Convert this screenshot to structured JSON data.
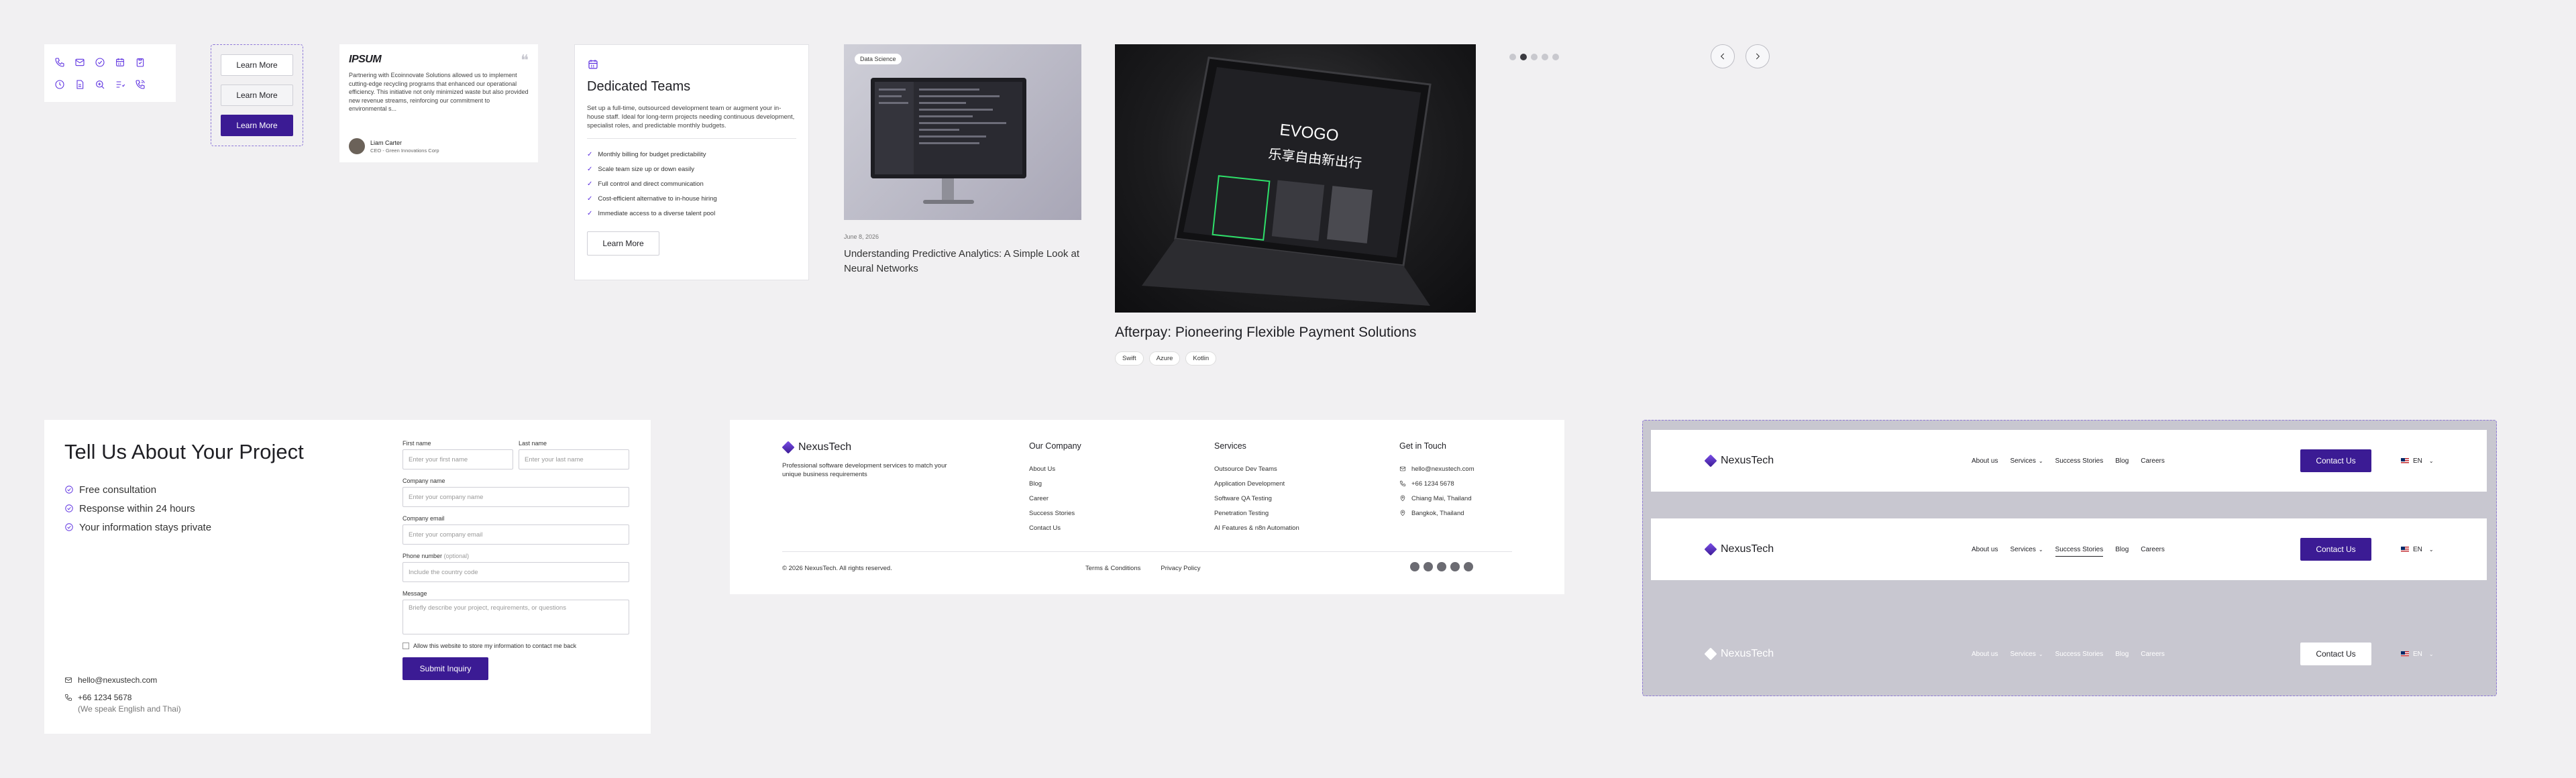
{
  "buttons": {
    "learn_more": "Learn More"
  },
  "icons": [
    "phone-icon",
    "mail-icon",
    "check-circle-icon",
    "calendar-icon",
    "clipboard-icon",
    "clock-icon",
    "document-icon",
    "search-plus-icon",
    "list-icon",
    "phone-call-icon"
  ],
  "testimonial": {
    "logo": "IPSUM",
    "quote": "Partnering with Ecoinnovate Solutions allowed us to implement cutting-edge recycling programs that enhanced our operational efficiency. This initiative not only minimized waste but also provided new revenue streams, reinforcing our commitment to environmental s...",
    "name": "Liam Carter",
    "role": "CEO - Green Innovations Corp"
  },
  "teams": {
    "title": "Dedicated Teams",
    "description": "Set up a full-time, outsourced development team or augment your in-house staff. Ideal for long-term projects needing continuous development, specialist roles, and predictable monthly budgets.",
    "features": [
      "Monthly billing for budget predictability",
      "Scale team size up or down easily",
      "Full control and direct communication",
      "Cost-efficient alternative to in-house hiring",
      "Immediate access to a diverse talent pool"
    ],
    "button": "Learn More"
  },
  "blog": {
    "badge": "Data Science",
    "date": "June 8, 2026",
    "headline": "Understanding Predictive Analytics: A Simple Look at Neural Networks"
  },
  "case_study": {
    "screen_brand": "EVOGO",
    "screen_cn": "乐享自由新出行",
    "headline": "Afterpay: Pioneering Flexible Payment Solutions",
    "tags": [
      "Swift",
      "Azure",
      "Kotlin"
    ]
  },
  "carousel": {
    "dot_count": 5,
    "active_index": 1
  },
  "project": {
    "title": "Tell Us About Your Project",
    "benefits": [
      "Free consultation",
      "Response within 24 hours",
      "Your information stays private"
    ],
    "email": "hello@nexustech.com",
    "phone": "+66 1234 5678",
    "phone_note": "(We speak English and Thai)",
    "form": {
      "first_name_label": "First name",
      "first_name_placeholder": "Enter your first name",
      "last_name_label": "Last name",
      "last_name_placeholder": "Enter your last name",
      "company_label": "Company name",
      "company_placeholder": "Enter your company name",
      "email_label": "Company email",
      "email_placeholder": "Enter your company email",
      "phone_label": "Phone number",
      "phone_optional": "(optional)",
      "phone_placeholder": "Include the country code",
      "message_label": "Message",
      "message_placeholder": "Briefly describe your project, requirements, or questions",
      "consent": "Allow this website to store my information to contact me back",
      "submit": "Submit Inquiry"
    }
  },
  "footer": {
    "brand": "NexusTech",
    "tagline": "Professional software development services to match your unique business requirements",
    "company": {
      "heading": "Our Company",
      "items": [
        "About Us",
        "Blog",
        "Career",
        "Success Stories",
        "Contact Us"
      ]
    },
    "services": {
      "heading": "Services",
      "items": [
        "Outsource Dev Teams",
        "Application Development",
        "Software QA Testing",
        "Penetration Testing",
        "AI Features & n8n Automation"
      ]
    },
    "contact": {
      "heading": "Get in Touch",
      "items": [
        "hello@nexustech.com",
        "+66 1234 5678",
        "Chiang Mai, Thailand",
        "Bangkok, Thailand"
      ]
    },
    "copyright": "© 2026 NexusTech. All rights reserved.",
    "terms": "Terms & Conditions",
    "privacy": "Privacy Policy",
    "socials": [
      "facebook-icon",
      "linkedin-icon",
      "youtube-icon",
      "instagram-icon",
      "telegram-icon"
    ]
  },
  "navbar": {
    "brand": "NexusTech",
    "links": [
      "About us",
      "Services",
      "Success Stories",
      "Blog",
      "Careers"
    ],
    "cta": "Contact Us",
    "lang": "EN"
  },
  "colors": {
    "accent": "#3b1b94",
    "icon": "#5b2ee0",
    "background": "#f1f0f2"
  }
}
